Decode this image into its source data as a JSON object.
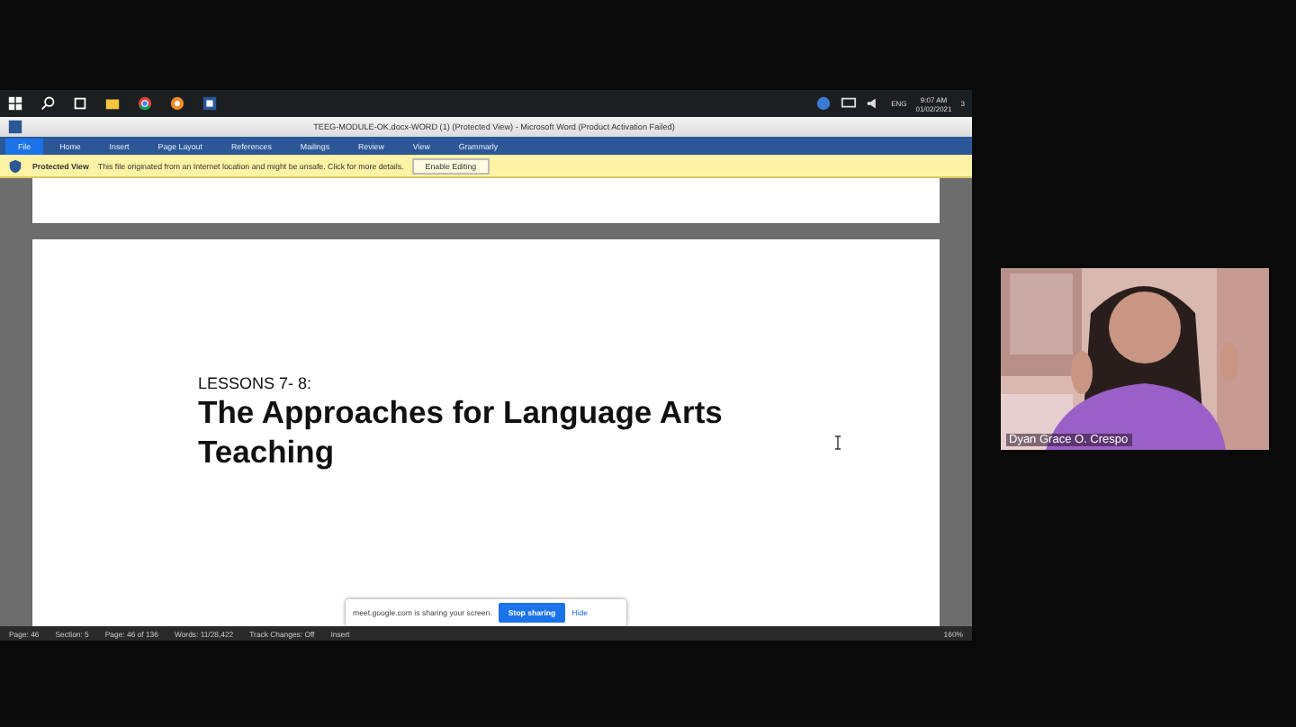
{
  "taskbar": {
    "language": "ENG",
    "time": "9:07 AM",
    "date": "01/02/2021",
    "notification_count": "3"
  },
  "word": {
    "title": "TEEG-MODULE-OK.docx-WORD (1) (Protected View) - Microsoft Word (Product Activation Failed)",
    "ribbon_tabs": [
      {
        "label": "File",
        "selected": true
      },
      {
        "label": "Home",
        "selected": false
      },
      {
        "label": "Insert",
        "selected": false
      },
      {
        "label": "Page Layout",
        "selected": false
      },
      {
        "label": "References",
        "selected": false
      },
      {
        "label": "Mailings",
        "selected": false
      },
      {
        "label": "Review",
        "selected": false
      },
      {
        "label": "View",
        "selected": false
      },
      {
        "label": "Grammarly",
        "selected": false
      }
    ],
    "protected_view": {
      "label": "Protected View",
      "message": "This file originated from an Internet location and might be unsafe. Click for more details.",
      "button": "Enable Editing"
    },
    "document": {
      "lesson": "LESSONS 7- 8:",
      "heading": "The Approaches for Language Arts Teaching"
    },
    "status_bar": {
      "items": [
        "Page: 46",
        "Section: 5",
        "Page: 46 of 136",
        "Words: 11/28,422",
        "Track Changes: Off",
        "Insert"
      ],
      "zoom": "160%"
    }
  },
  "share_notice": {
    "message": "meet.google.com is sharing your screen.",
    "stop_button": "Stop sharing",
    "hide_button": "Hide"
  },
  "participant": {
    "name": "Dyan Grace O. Crespo"
  }
}
